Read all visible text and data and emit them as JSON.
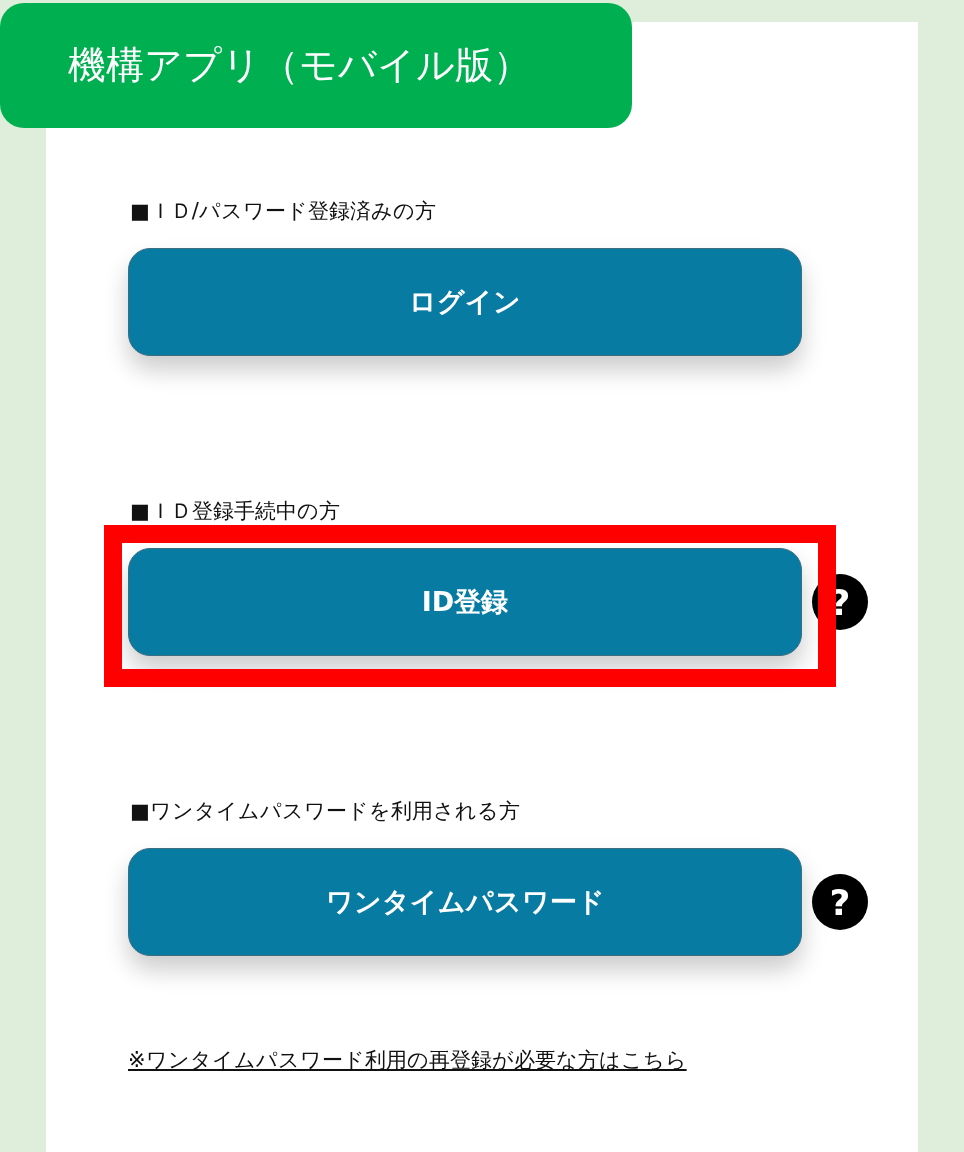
{
  "title": "機構アプリ（モバイル版）",
  "sections": [
    {
      "label": "■ＩＤ/パスワード登録済みの方",
      "button": "ログイン",
      "highlighted": false
    },
    {
      "label": "■ＩＤ登録手続中の方",
      "button": "ID登録",
      "help": "?",
      "highlighted": true
    },
    {
      "label": "■ワンタイムパスワードを利用される方",
      "button": "ワンタイムパスワード",
      "help": "?",
      "highlighted": false
    }
  ],
  "link": "※ワンタイムパスワード利用の再登録が必要な方はこちら"
}
